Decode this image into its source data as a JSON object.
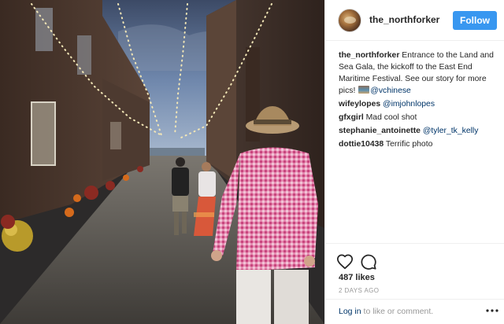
{
  "account": {
    "username": "the_northforker",
    "follow_label": "Follow"
  },
  "caption": {
    "username": "the_northforker",
    "text": "Entrance to the Land and Sea Gala, the kickoff to the East End Maritime Festival. See our story for more pics!",
    "mention": "@vchinese"
  },
  "comments": [
    {
      "username": "wifeylopes",
      "text": "",
      "mention": "@imjohnlopes"
    },
    {
      "username": "gfxgirl",
      "text": "Mad cool shot",
      "mention": ""
    },
    {
      "username": "stephanie_antoinette",
      "text": "",
      "mention": "@tyler_tk_kelly"
    },
    {
      "username": "dottie10438",
      "text": "Terrific photo",
      "mention": ""
    }
  ],
  "likes": "487 likes",
  "timestamp": "2 DAYS AGO",
  "login_prompt": {
    "link": "Log in",
    "rest": " to like or comment."
  },
  "icons": {
    "like": "heart-icon",
    "comment": "comment-bubble-icon",
    "more": "more-options-icon"
  },
  "colors": {
    "accent": "#3897f0",
    "link": "#003569",
    "muted": "#999999"
  }
}
